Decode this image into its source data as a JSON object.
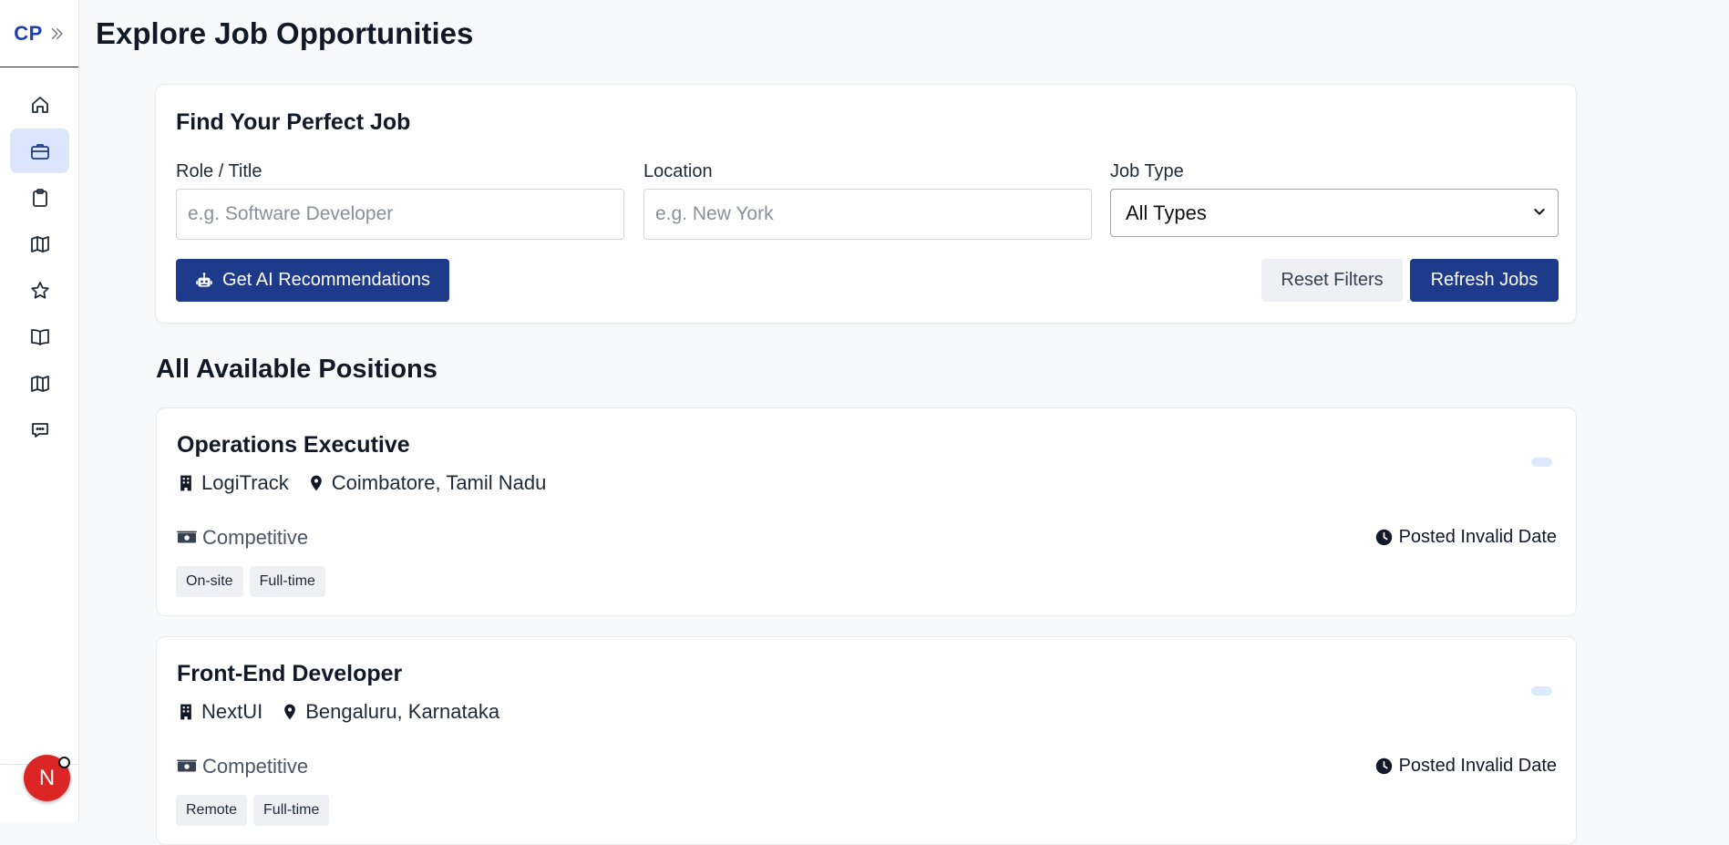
{
  "app": {
    "logo": "CP"
  },
  "sidebar": {
    "items": [
      {
        "icon": "home-icon",
        "active": false
      },
      {
        "icon": "briefcase-icon",
        "active": true
      },
      {
        "icon": "clipboard-icon",
        "active": false
      },
      {
        "icon": "map-icon",
        "active": false
      },
      {
        "icon": "star-icon",
        "active": false
      },
      {
        "icon": "book-icon",
        "active": false
      },
      {
        "icon": "map-icon",
        "active": false
      },
      {
        "icon": "chat-icon",
        "active": false
      }
    ],
    "avatar_initial": "N"
  },
  "page": {
    "title": "Explore Job Opportunities"
  },
  "search": {
    "title": "Find Your Perfect Job",
    "role_label": "Role / Title",
    "role_placeholder": "e.g. Software Developer",
    "location_label": "Location",
    "location_placeholder": "e.g. New York",
    "jobtype_label": "Job Type",
    "jobtype_value": "All Types",
    "ai_button": "Get AI Recommendations",
    "reset_button": "Reset Filters",
    "refresh_button": "Refresh Jobs"
  },
  "listing": {
    "title": "All Available Positions",
    "jobs": [
      {
        "title": "Operations Executive",
        "company": "LogiTrack",
        "location": "Coimbatore, Tamil Nadu",
        "salary": "Competitive",
        "posted": "Posted Invalid Date",
        "tags": [
          "On-site",
          "Full-time"
        ]
      },
      {
        "title": "Front-End Developer",
        "company": "NextUI",
        "location": "Bengaluru, Karnataka",
        "salary": "Competitive",
        "posted": "Posted Invalid Date",
        "tags": [
          "Remote",
          "Full-time"
        ]
      }
    ]
  },
  "colors": {
    "primary": "#1e3a8a",
    "logo": "#1e40af",
    "active_nav": "#dbe5fb",
    "avatar": "#dc2626"
  }
}
